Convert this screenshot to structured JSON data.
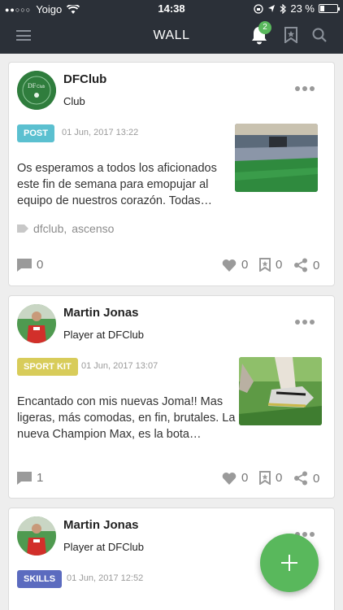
{
  "status_bar": {
    "signal": "●●○○○",
    "carrier": "Yoigo",
    "time": "14:38",
    "battery": "23 %",
    "battery_level": 0.23
  },
  "navbar": {
    "title": "WALL",
    "notification_count": "2",
    "icons": [
      "menu-icon",
      "bell-icon",
      "bookmark-icon",
      "search-icon"
    ]
  },
  "colors": {
    "nav_background": "#2b3038",
    "accent_green": "#59b85c",
    "tag_post": "#5bc0d0",
    "tag_sport_kit": "#d8cc5a",
    "tag_skills": "#5b6bbf"
  },
  "posts": [
    {
      "author": "DFClub",
      "role": "Club",
      "tag": "POST",
      "date": "01 Jun, 2017 13:22",
      "text": "Os esperamos a todos los aficionados este fin de semana para emopujar al equipo de nuestros corazón. Todas…",
      "hashtags": [
        "dfclub,",
        "ascenso"
      ],
      "comments": "0",
      "likes": "0",
      "saves": "0",
      "shares": "0"
    },
    {
      "author": "Martin Jonas",
      "role": "Player at DFClub",
      "tag": "SPORT KIT",
      "date": "01 Jun, 2017 13:07",
      "text": "Encantado con mis nuevas Joma!! Mas ligeras, más comodas, en fin, brutales. La nueva Champion Max, es la bota…",
      "comments": "1",
      "likes": "0",
      "saves": "0",
      "shares": "0"
    },
    {
      "author": "Martin Jonas",
      "role": "Player at DFClub",
      "tag": "SKILLS",
      "date": "01 Jun, 2017 12:52"
    }
  ]
}
